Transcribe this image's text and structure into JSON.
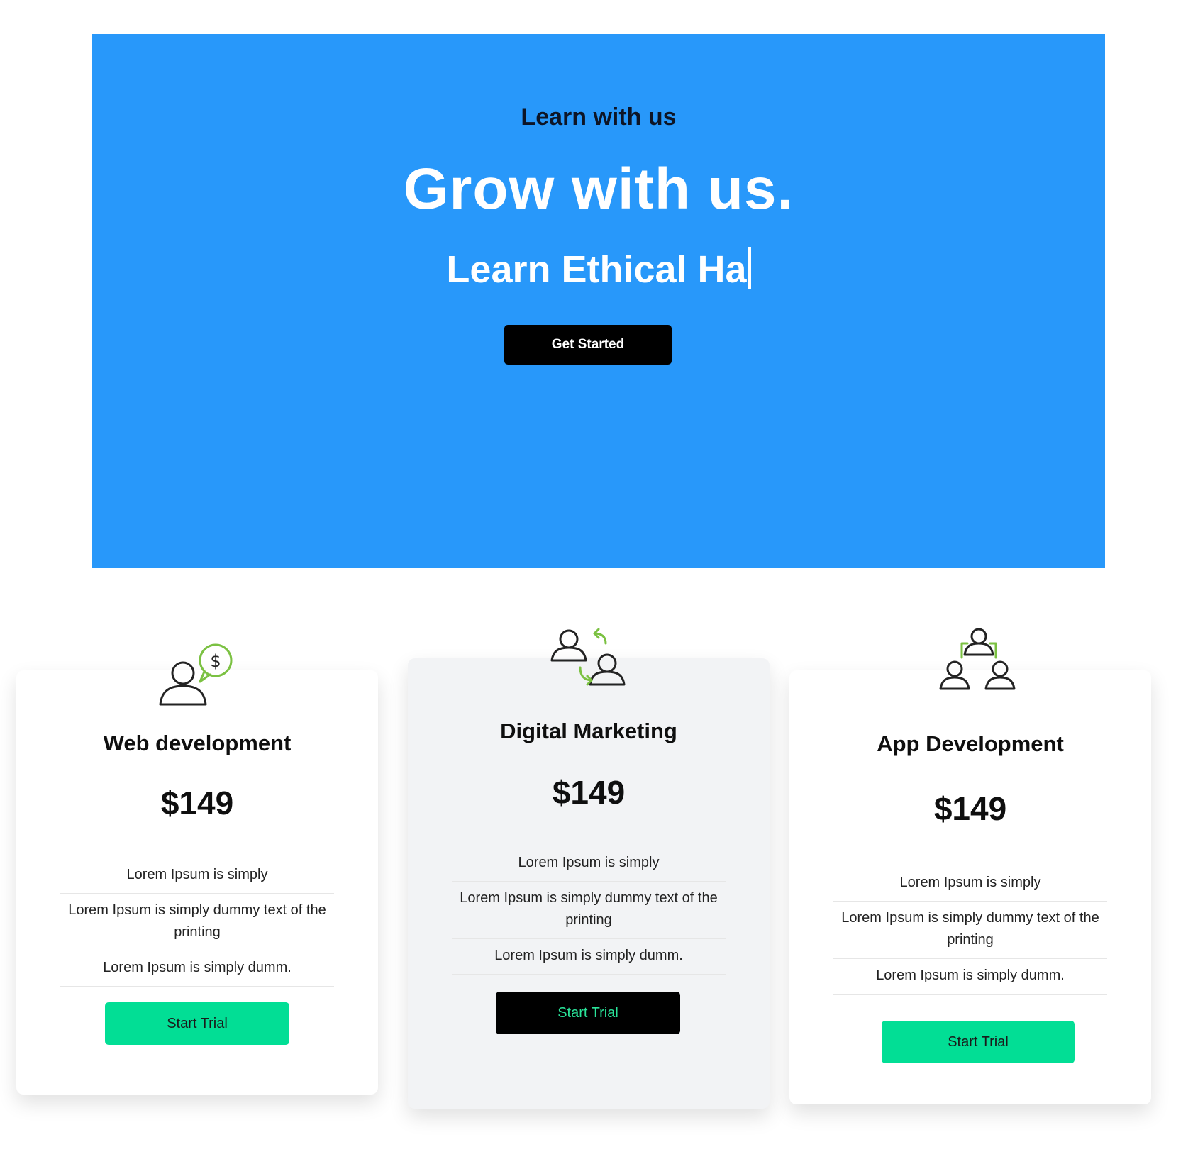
{
  "hero": {
    "eyebrow": "Learn with us",
    "title": "Grow with us.",
    "typed_text": "Learn Ethical Ha",
    "cta_label": "Get Started",
    "background_color": "#2898fa"
  },
  "plans": [
    {
      "icon": "person-dollar-icon",
      "title": "Web development",
      "price": "$149",
      "features": [
        "Lorem Ipsum is simply",
        "Lorem Ipsum is simply dummy text of the printing",
        "Lorem Ipsum is simply dumm."
      ],
      "button_label": "Start Trial",
      "button_color": "#02de95"
    },
    {
      "icon": "people-exchange-icon",
      "title": "Digital Marketing",
      "price": "$149",
      "features": [
        "Lorem Ipsum is simply",
        "Lorem Ipsum is simply dummy text of the printing",
        "Lorem Ipsum is simply dumm."
      ],
      "button_label": "Start Trial",
      "button_color": "#000000"
    },
    {
      "icon": "team-group-icon",
      "title": "App Development",
      "price": "$149",
      "features": [
        "Lorem Ipsum is simply",
        "Lorem Ipsum is simply dummy text of the printing",
        "Lorem Ipsum is simply dumm."
      ],
      "button_label": "Start Trial",
      "button_color": "#02de95"
    }
  ]
}
